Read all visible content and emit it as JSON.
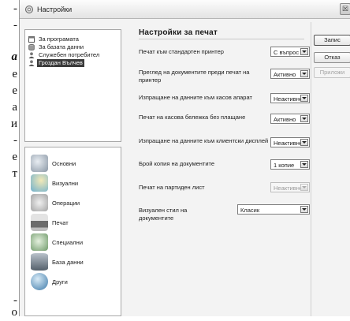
{
  "background_text": [
    "-",
    "-",
    "a",
    "e",
    "e",
    "a",
    "и",
    "-",
    "e",
    "т",
    "-",
    "o"
  ],
  "window": {
    "title": "Настройки",
    "close_glyph": "☒"
  },
  "tree": {
    "items": [
      {
        "label": "За програмата",
        "icon": "window-icon",
        "selected": false
      },
      {
        "label": "За базата данни",
        "icon": "database-icon",
        "selected": false
      },
      {
        "label": "Служебен потребител",
        "icon": "user-icon",
        "selected": false
      },
      {
        "label": "Гроздан Вълчев",
        "icon": "user-icon",
        "selected": true
      }
    ]
  },
  "categories": [
    {
      "label": "Основни",
      "icon": "settings-icon",
      "color": "#9aa7b5"
    },
    {
      "label": "Визуални",
      "icon": "palette-icon",
      "color": "#8fc3d8"
    },
    {
      "label": "Операции",
      "icon": "operations-icon",
      "color": "#b9b9b9"
    },
    {
      "label": "Печат",
      "icon": "printer-icon",
      "color": "#7d7d7d"
    },
    {
      "label": "Специални",
      "icon": "special-icon",
      "color": "#8cb38a"
    },
    {
      "label": "База данни",
      "icon": "database-icon",
      "color": "#6f7d8a"
    },
    {
      "label": "Други",
      "icon": "other-icon",
      "color": "#5e8fb8"
    }
  ],
  "settings": {
    "title": "Настройки за печат",
    "options": [
      {
        "label": "Печат към стандартен принтер",
        "value": "С въпрос",
        "disabled": false
      },
      {
        "label": "Преглед на документите преди печат на принтер",
        "value": "Активно",
        "disabled": false
      },
      {
        "label": "Изпращане на данните към касов апарат",
        "value": "Неактивно",
        "disabled": false
      },
      {
        "label": "Печат на касова бележка без плащане",
        "value": "Активно",
        "disabled": false
      },
      {
        "label": "Изпращане на данните към клиентски дисплей",
        "value": "Неактивно",
        "disabled": false
      },
      {
        "label": "Брой копия на документите",
        "value": "1 копие",
        "disabled": false
      },
      {
        "label": "Печат на партиден лист",
        "value": "Неактивно",
        "disabled": true
      },
      {
        "label": "Визуален стил на документите",
        "value": "Класик",
        "disabled": false
      }
    ]
  },
  "buttons": {
    "save": "Запис",
    "cancel": "Отказ",
    "apply": "Приложи"
  }
}
